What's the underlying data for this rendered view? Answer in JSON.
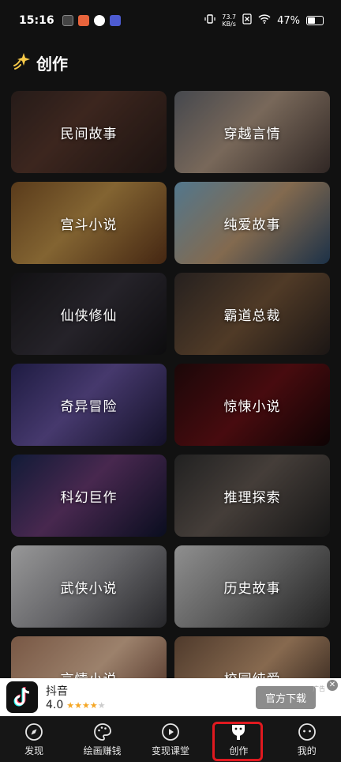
{
  "status": {
    "time": "15:16",
    "net_speed_value": "73.7",
    "net_speed_unit": "KB/s",
    "battery": "47%"
  },
  "header": {
    "title": "创作",
    "icon": "sparkle-icon"
  },
  "categories": [
    {
      "label": "民间故事"
    },
    {
      "label": "穿越言情"
    },
    {
      "label": "宫斗小说"
    },
    {
      "label": "纯爱故事"
    },
    {
      "label": "仙侠修仙"
    },
    {
      "label": "霸道总裁"
    },
    {
      "label": "奇异冒险"
    },
    {
      "label": "惊悚小说"
    },
    {
      "label": "科幻巨作"
    },
    {
      "label": "推理探索"
    },
    {
      "label": "武侠小说"
    },
    {
      "label": "历史故事"
    },
    {
      "label": "言情小说"
    },
    {
      "label": "校园纯爱"
    }
  ],
  "ad": {
    "app_name": "抖音",
    "rating": "4.0",
    "rating_stars": 4,
    "button_label": "官方下载",
    "tag": "广告",
    "close_label": "✕"
  },
  "nav": {
    "items": [
      {
        "label": "发现",
        "icon": "compass-icon"
      },
      {
        "label": "绘画赚钱",
        "icon": "palette-icon"
      },
      {
        "label": "变现课堂",
        "icon": "play-icon"
      },
      {
        "label": "创作",
        "icon": "create-icon",
        "active": true
      },
      {
        "label": "我的",
        "icon": "profile-face-icon"
      }
    ]
  },
  "colors": {
    "background": "#111111",
    "active_highlight": "#e0191f",
    "star": "#f5a623"
  }
}
